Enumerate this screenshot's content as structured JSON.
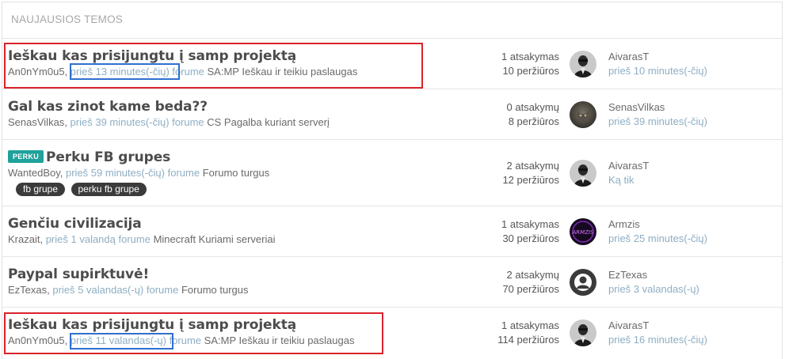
{
  "header": {
    "title": "NAUJAUSIOS TEMOS"
  },
  "topics": [
    {
      "title": "Ieškau kas prisijungtu į samp projektą",
      "author": "An0nYm0u5",
      "time": "prieš 13 minutes(-čių)",
      "forum_word": "forume",
      "forum": "SA:MP Ieškau ir teikiu paslaugas",
      "replies": "1 atsakymas",
      "views": "10 peržiūros",
      "avatar": "avatar-aivarast",
      "last_user": "AivarasT",
      "last_time": "prieš 10 minutes(-čių)"
    },
    {
      "title": "Gal kas zinot kame beda??",
      "author": "SenasVilkas",
      "time": "prieš 39 minutes(-čių)",
      "forum_word": "forume",
      "forum": "CS Pagalba kuriant serverį",
      "replies": "0 atsakymų",
      "views": "8 peržiūros",
      "avatar": "avatar-senasvilkas",
      "last_user": "SenasVilkas",
      "last_time": "prieš 39 minutes(-čių)"
    },
    {
      "prefix": "PERKU",
      "title": "Perku FB grupes",
      "author": "WantedBoy",
      "time": "prieš 59 minutes(-čių)",
      "forum_word": "forume",
      "forum": "Forumo turgus",
      "tags": [
        "fb grupe",
        "perku fb grupe"
      ],
      "replies": "2 atsakymų",
      "views": "12 peržiūros",
      "avatar": "avatar-aivarast",
      "last_user": "AivarasT",
      "last_time": "Ką tik"
    },
    {
      "title": "Genčiu civilizacija",
      "author": "Krazait",
      "time": "prieš 1 valandą",
      "forum_word": "forume",
      "forum": "Minecraft Kuriami serveriai",
      "replies": "1 atsakymas",
      "views": "30 peržiūros",
      "avatar": "avatar-armzis",
      "avatar_text": "ARMZIS",
      "last_user": "Armzis",
      "last_time": "prieš 25 minutes(-čių)"
    },
    {
      "title": "Paypal supirktuvė!",
      "author": "EzTexas",
      "time": "prieš 5 valandas(-ų)",
      "forum_word": "forume",
      "forum": "Forumo turgus",
      "replies": "2 atsakymų",
      "views": "70 peržiūros",
      "avatar": "avatar-default",
      "last_user": "EzTexas",
      "last_time": "prieš 3 valandas(-ų)"
    },
    {
      "title": "Ieškau kas prisijungtu į samp projektą",
      "author": "An0nYm0u5",
      "time": "prieš 11 valandas(-ų)",
      "forum_word": "forume",
      "forum": "SA:MP Ieškau ir teikiu paslaugas",
      "replies": "1 atsakymas",
      "views": "114 peržiūros",
      "avatar": "avatar-aivarast",
      "last_user": "AivarasT",
      "last_time": "prieš 16 minutes(-čių)"
    }
  ],
  "colors": {
    "prefix_bg": "#1fa19c",
    "tag_bg": "#3b3b3b",
    "link_blue": "#8eaec3",
    "highlight_red": "#d9232b",
    "highlight_blue": "#2f6fd0"
  }
}
